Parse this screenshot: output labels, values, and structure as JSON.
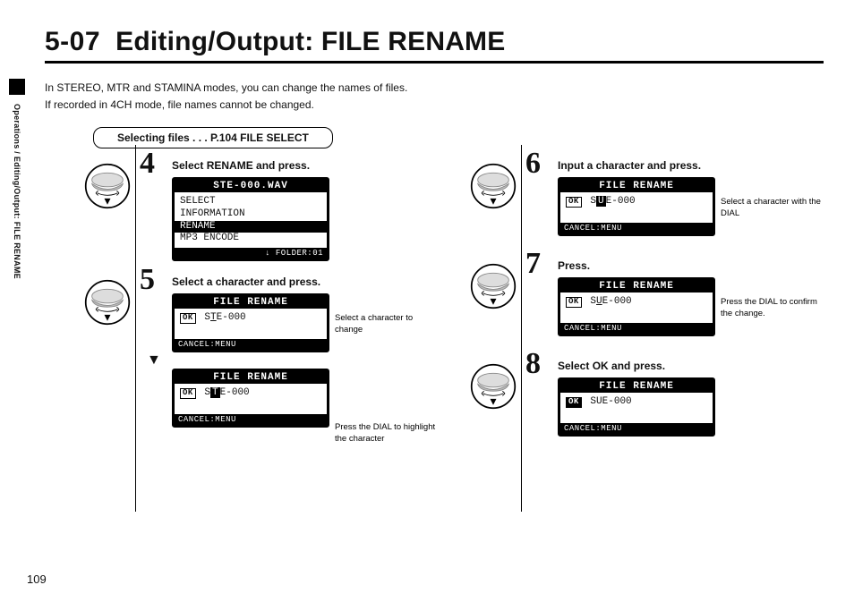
{
  "heading": {
    "section": "5-07",
    "title": "Editing/Output: FILE RENAME"
  },
  "intro_line1": "In STEREO, MTR and STAMINA modes, you can change the names of files.",
  "intro_line2": "If recorded in 4CH mode, file names cannot be changed.",
  "sidetab": "Operations / Editing/Output: FILE RENAME",
  "pill": "Selecting files . . . P.104 FILE SELECT",
  "page_number": "109",
  "steps": {
    "s4": {
      "num": "4",
      "title": "Select RENAME and press.",
      "lcd": {
        "top": "STE-000.WAV",
        "rows": [
          "SELECT",
          "INFORMATION",
          "RENAME",
          "MP3 ENCODE"
        ],
        "sel_index": 2,
        "footer": "FOLDER:01",
        "footer_icon": "↓"
      }
    },
    "s5": {
      "num": "5",
      "title": "Select a character and press.",
      "lcd_a": {
        "top": "FILE RENAME",
        "value_pre": "S",
        "value_cur": "T",
        "value_post": "E-000",
        "footer": "CANCEL:MENU"
      },
      "lcd_b": {
        "top": "FILE RENAME",
        "value_pre": "S",
        "value_cur": "T",
        "value_post": "E-000",
        "footer": "CANCEL:MENU"
      },
      "note_a": "Select a character to change",
      "note_b": "Press the DIAL to highlight the character"
    },
    "s6": {
      "num": "6",
      "title": "Input a character and press.",
      "lcd": {
        "top": "FILE RENAME",
        "value_pre": "S",
        "value_cur": "U",
        "value_post": "E-000",
        "footer": "CANCEL:MENU"
      },
      "note": "Select a character with the DIAL"
    },
    "s7": {
      "num": "7",
      "title": "Press.",
      "lcd": {
        "top": "FILE RENAME",
        "value_pre": "S",
        "value_cur": "U",
        "value_post": "E-000",
        "footer": "CANCEL:MENU"
      },
      "note": "Press the DIAL to confirm the change."
    },
    "s8": {
      "num": "8",
      "title": "Select OK and press.",
      "lcd": {
        "top": "FILE RENAME",
        "value_pre": "S",
        "value_cur": "U",
        "value_post": "E-000",
        "footer": "CANCEL:MENU",
        "ok_selected": true
      }
    }
  }
}
